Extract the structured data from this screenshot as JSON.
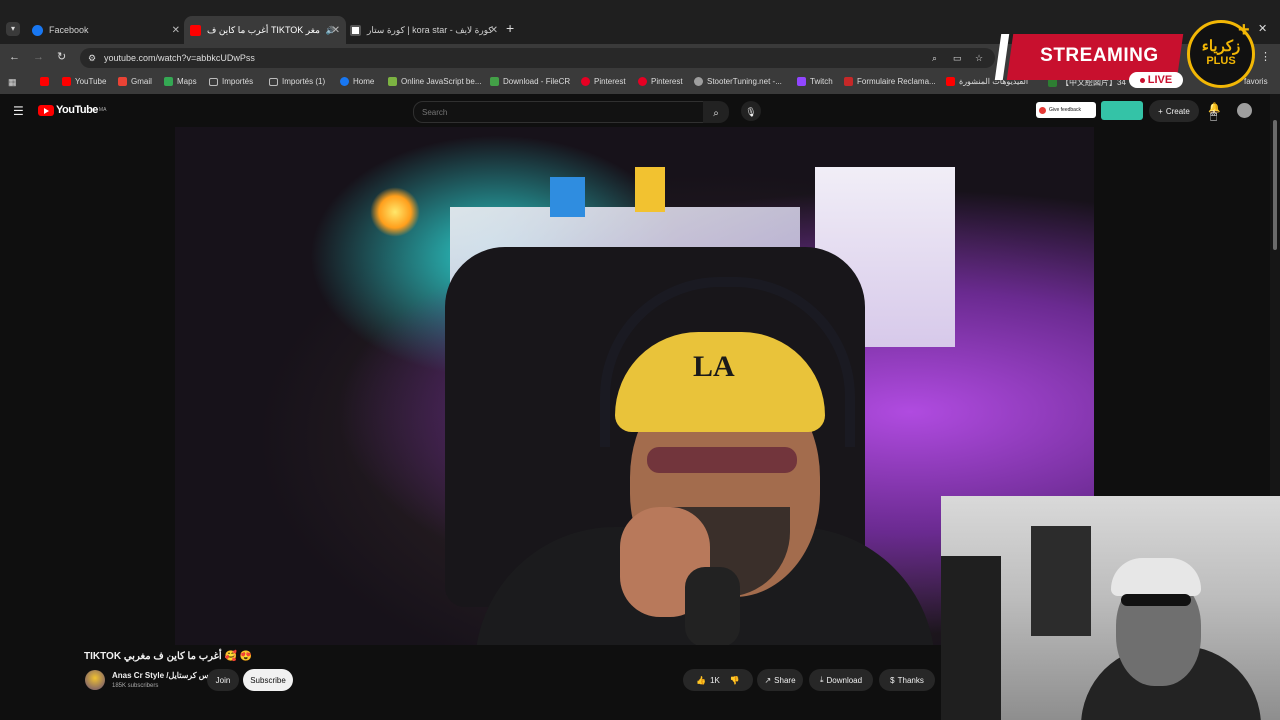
{
  "browser": {
    "tabs": [
      {
        "label": "Facebook",
        "favicon_color": "#1877f2"
      },
      {
        "label": "مغر TIKTOK أغرب ما كاين ف",
        "favicon_color": "#ff0000"
      },
      {
        "label": "كورة ستار | kora star - كورة لايف",
        "favicon_color": "#ffffff"
      }
    ],
    "new_tab": "+",
    "address": "youtube.com/watch?v=abbkcUDwPss",
    "bookmarks": [
      {
        "label": "",
        "color": "#ff0000"
      },
      {
        "label": "YouTube",
        "color": "#ff0000"
      },
      {
        "label": "Gmail",
        "color": "#ea4335"
      },
      {
        "label": "Maps",
        "color": "#34a853"
      },
      {
        "label": "Importés",
        "color": "#bbbbbb"
      },
      {
        "label": "Importés (1)",
        "color": "#bbbbbb"
      },
      {
        "label": "Home",
        "color": "#1877f2"
      },
      {
        "label": "Online JavaScript be...",
        "color": "#7cb342"
      },
      {
        "label": "Download - FileCR",
        "color": "#43a047"
      },
      {
        "label": "Pinterest",
        "color": "#e60023"
      },
      {
        "label": "Pinterest",
        "color": "#e60023"
      },
      {
        "label": "StooterTuning.net -...",
        "color": "#9e9e9e"
      },
      {
        "label": "Twitch",
        "color": "#9146ff"
      },
      {
        "label": "Formulaire Reclama...",
        "color": "#c62828"
      },
      {
        "label": "الفيديوهات المنشورة",
        "color": "#ff0000"
      },
      {
        "label": "【中文絵図片】34",
        "color": "#2e7d32"
      }
    ],
    "all_favorites": "favoris"
  },
  "youtube": {
    "logo": "YouTube",
    "country": "MA",
    "search_placeholder": "Search",
    "feedback": "Give feedback",
    "create": "Create"
  },
  "overlay": {
    "streaming": "STREAMING",
    "live": "LIVE",
    "brand_top": "زكرياء",
    "brand_bottom": "PLUS"
  },
  "video": {
    "title": "TIKTOK أغرب ما كاين ف مغربي 🥰 😍",
    "channel": "Anas Cr Style /انس كرستايل",
    "subscribers": "185K subscribers",
    "join": "Join",
    "subscribe": "Subscribe",
    "likes": "1K",
    "share": "Share",
    "download": "Download",
    "thanks": "Thanks",
    "cap_logo": "LA"
  }
}
